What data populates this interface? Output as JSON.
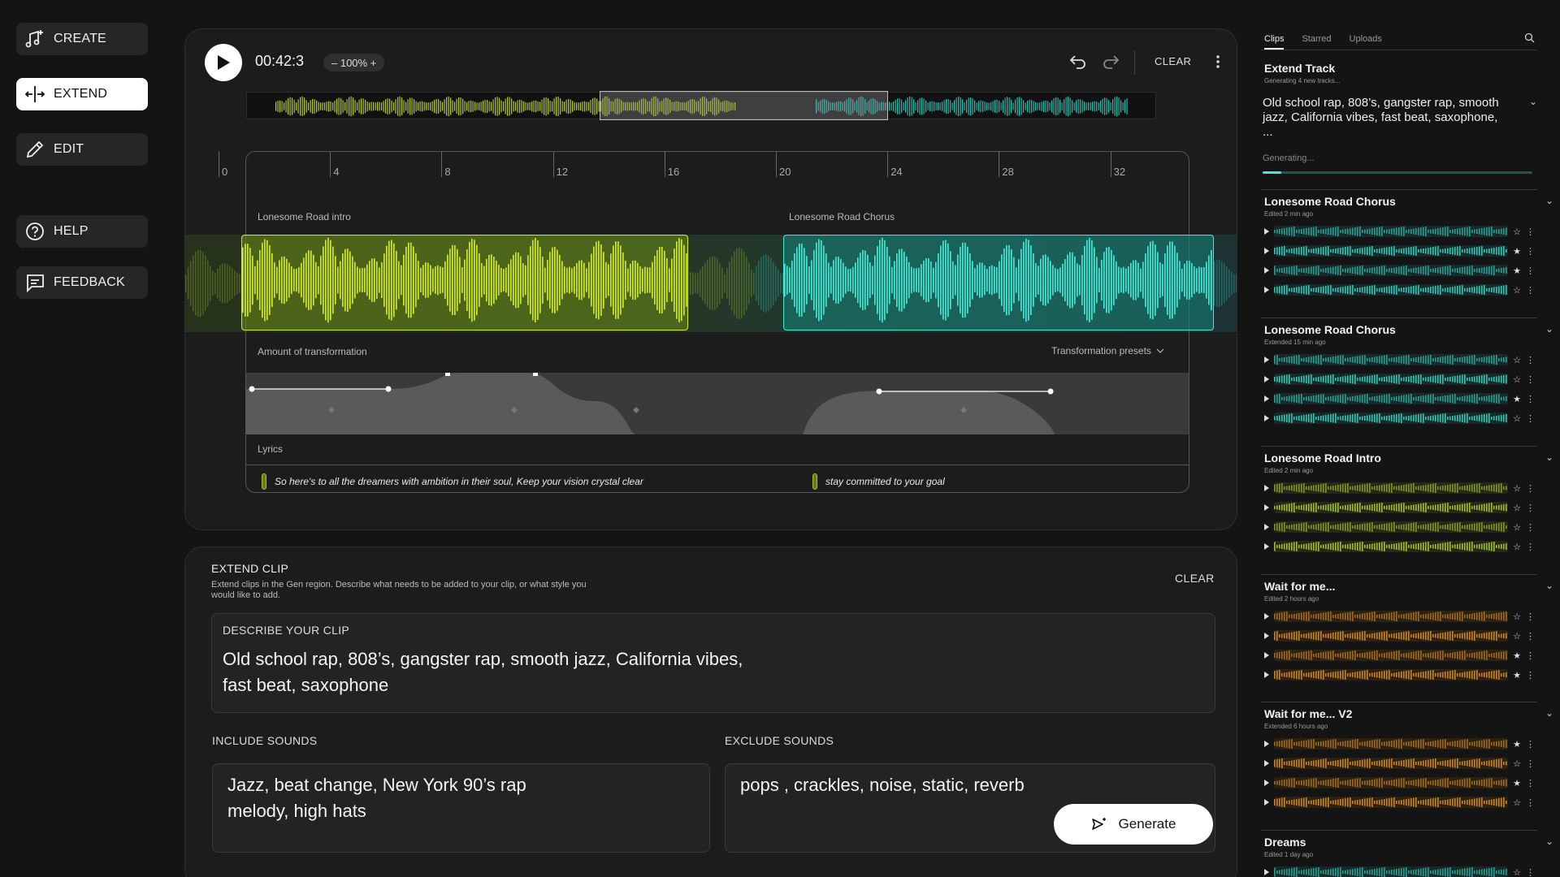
{
  "nav": {
    "create": "CREATE",
    "extend": "EXTEND",
    "edit": "EDIT",
    "help": "HELP",
    "feedback": "FEEDBACK"
  },
  "player": {
    "timecode": "00:42:3",
    "zoom": "– 100% +",
    "clear": "CLEAR"
  },
  "timeline": {
    "ticks": [
      "0",
      "4",
      "8",
      "12",
      "16",
      "20",
      "24",
      "28",
      "32"
    ],
    "clip_a_label": "Lonesome Road intro",
    "clip_b_label": "Lonesome Road Chorus",
    "transform_label": "Amount of transformation",
    "presets_label": "Transformation presets",
    "lyrics_label": "Lyrics",
    "lyric_a": "So here's to all the dreamers with ambition in their soul, Keep your vision crystal clear",
    "lyric_b": "stay committed to your goal"
  },
  "extend_panel": {
    "title": "EXTEND CLIP",
    "description": "Extend clips in the Gen region. Describe what needs to be added to your clip, or what style you would like to add.",
    "clear": "CLEAR",
    "describe_label": "DESCRIBE YOUR CLIP",
    "describe_text_1": "Old school rap, 808’s, gangster rap, smooth jazz, California vibes,",
    "describe_text_2": "fast beat, saxophone",
    "include_label": "INCLUDE SOUNDS",
    "include_text_1": "Jazz, beat change, New York 90’s rap",
    "include_text_2": "melody, high hats",
    "exclude_label": "EXCLUDE SOUNDS",
    "exclude_text": "pops , crackles, noise, static, reverb",
    "generate": "Generate"
  },
  "sidebar": {
    "tabs": [
      "Clips",
      "Starred",
      "Uploads"
    ],
    "extend_track": {
      "title": "Extend Track",
      "sub": "Generating 4 new tracks...",
      "prompt": "Old school rap, 808’s, gangster rap, smooth jazz, California vibes, fast beat, saxophone, ...",
      "status": "Generating...",
      "progress": 0.07
    },
    "groups": [
      {
        "title": "Lonesome Road Chorus",
        "sub": "Edited 2 min ago",
        "color": "#2fcfc0",
        "stars": [
          "☆",
          "★",
          "★",
          "☆"
        ]
      },
      {
        "title": "Lonesome Road Chorus",
        "sub": "Extended 15 min ago",
        "color": "#2fcfc0",
        "stars": [
          "☆",
          "☆",
          "★",
          "☆"
        ]
      },
      {
        "title": "Lonesome Road Intro",
        "sub": "Edited 2 min ago",
        "color": "#a6c726",
        "stars": [
          "☆",
          "☆",
          "☆",
          "☆"
        ]
      },
      {
        "title": "Wait for me...",
        "sub": "Edited 2 hours ago",
        "color": "#d4891c",
        "stars": [
          "☆",
          "☆",
          "★",
          "★"
        ]
      },
      {
        "title": "Wait for me... V2",
        "sub": "Extended 6 hours ago",
        "color": "#d4891c",
        "stars": [
          "★",
          "☆",
          "★",
          "☆"
        ]
      },
      {
        "title": "Dreams",
        "sub": "Edited 1 day ago",
        "color": "#2fcfc0",
        "stars": [
          "☆"
        ]
      }
    ]
  }
}
